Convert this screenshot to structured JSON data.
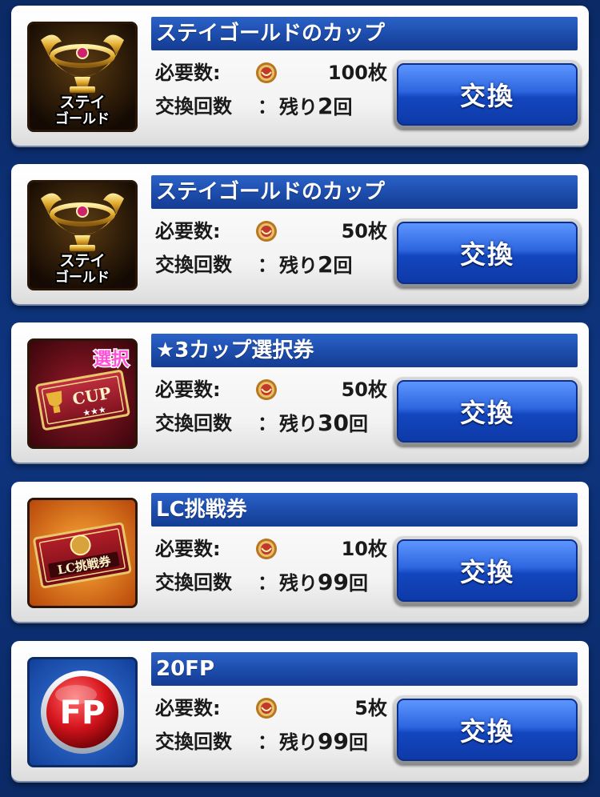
{
  "common": {
    "req_label": "必要数:",
    "count_label": "交換回数",
    "colon": "：",
    "remain_prefix": "残り",
    "remain_suffix": "回",
    "button_label": "交換"
  },
  "items": [
    {
      "title": "ステイゴールドのカップ",
      "cost": "100枚",
      "remaining": "2",
      "icon": "stay-gold-cup-icon",
      "icon_text": [
        "ステイ",
        "ゴールド"
      ]
    },
    {
      "title": "ステイゴールドのカップ",
      "cost": "50枚",
      "remaining": "2",
      "icon": "stay-gold-cup-icon",
      "icon_text": [
        "ステイ",
        "ゴールド"
      ]
    },
    {
      "title": "★3カップ選択券",
      "cost": "50枚",
      "remaining": "30",
      "icon": "cup-select-ticket-icon",
      "icon_text": [
        "選択",
        "CUP",
        "★★★"
      ]
    },
    {
      "title": "LC挑戦券",
      "cost": "10枚",
      "remaining": "99",
      "icon": "lc-challenge-ticket-icon",
      "icon_text": [
        "LC挑戦券"
      ]
    },
    {
      "title": "20FP",
      "cost": "5枚",
      "remaining": "99",
      "icon": "fp-icon",
      "icon_text": [
        "FP"
      ]
    }
  ],
  "colors": {
    "background": "#0e3580",
    "title_bar": "#1b4aa8",
    "button": "#2d66df"
  }
}
